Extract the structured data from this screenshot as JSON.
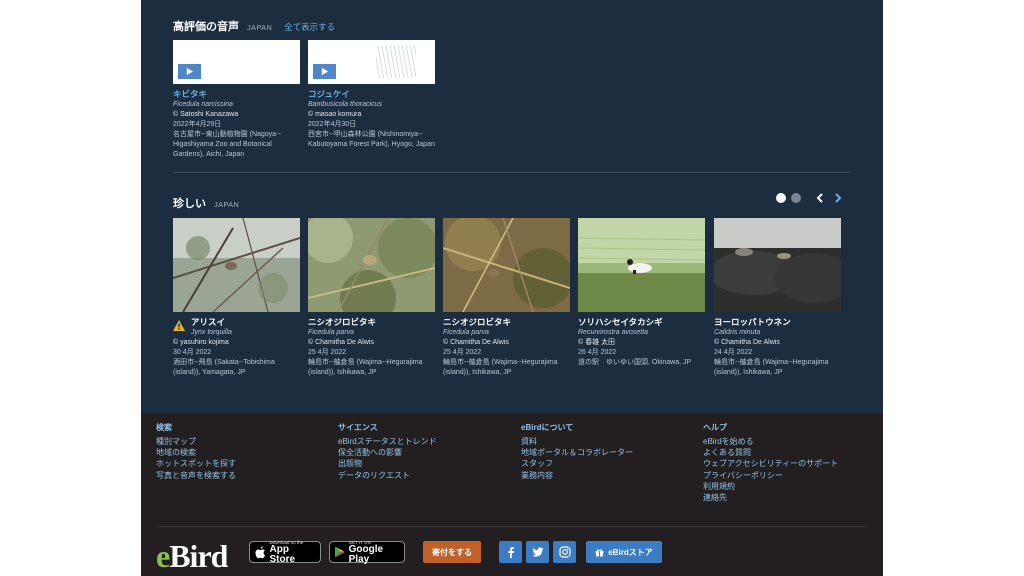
{
  "top_rated": {
    "title": "高評価の音声",
    "region": "JAPAN",
    "show_all": "全て表示する",
    "cards": [
      {
        "common": "キビタキ",
        "scientific": "Ficedula narcissina",
        "recorder": "© Satoshi Kanazawa",
        "date": "2022年4月29日",
        "location": "名古屋市--東山動植物園 (Nagoya--Higashiyama Zoo and Botanical Gardens), Aichi, Japan"
      },
      {
        "common": "コジュケイ",
        "scientific": "Bambusicola thoracicus",
        "recorder": "© masao komura",
        "date": "2022年4月30日",
        "location": "西宮市--甲山森林公園 (Nishinomiya--Kabutoyama Forest Park), Hyogo, Japan"
      }
    ]
  },
  "rare": {
    "title": "珍しい",
    "region": "JAPAN",
    "cards": [
      {
        "common": "アリスイ",
        "scientific": "Jynx torquilla",
        "recorder": "© yasuhiro kojima",
        "date": "30 4月 2022",
        "location": "酒田市--飛島 (Sakata--Tobishima (island)), Yamagata, JP",
        "warning": true
      },
      {
        "common": "ニシオジロビタキ",
        "scientific": "Ficedula parva",
        "recorder": "© Chamitha De Alwis",
        "date": "25 4月 2022",
        "location": "輪島市--舳倉島 (Wajima--Hegurajima (island)), Ishikawa, JP"
      },
      {
        "common": "ニシオジロビタキ",
        "scientific": "Ficedula parva",
        "recorder": "© Chamitha De Alwis",
        "date": "25 4月 2022",
        "location": "輪島市--舳倉島 (Wajima--Hegurajima (island)), Ishikawa, JP"
      },
      {
        "common": "ソリハシセイタカシギ",
        "scientific": "Recurvirostra avosetta",
        "recorder": "© 春雄 太田",
        "date": "26 4月 2022",
        "location": "道の駅　ゆいゆい国頭, Okinawa, JP"
      },
      {
        "common": "ヨーロッパトウネン",
        "scientific": "Calidris minuta",
        "recorder": "© Chamitha De Alwis",
        "date": "24 4月 2022",
        "location": "輪島市--舳倉島 (Wajima--Hegurajima (island)), Ishikawa, JP"
      }
    ]
  },
  "footer": {
    "columns": [
      {
        "heading": "検索",
        "links": [
          "種別マップ",
          "地域の検索",
          "ホットスポットを探す",
          "写真と音声を検索する"
        ]
      },
      {
        "heading": "サイエンス",
        "links": [
          "eBirdステータスとトレンド",
          "保全活動への影響",
          "出版物",
          "データのリクエスト"
        ]
      },
      {
        "heading": "eBirdについて",
        "links": [
          "資料",
          "地域ポータル＆コラボレーター",
          "スタッフ",
          "業務内容"
        ]
      },
      {
        "heading": "ヘルプ",
        "links": [
          "eBirdを始める",
          "よくある質問",
          "ウェブアクセシビリティーのサポート",
          "プライバシーポリシー",
          "利用規約",
          "連絡先"
        ]
      }
    ],
    "logo": "eBird",
    "app_store_small": "Download on the",
    "app_store_big": "App Store",
    "google_small": "GET IT ON",
    "google_big": "Google Play",
    "donate": "寄付をする",
    "store": "eBirdストア"
  },
  "colors": {
    "page_bg": "#1c2d3f",
    "footer_bg": "#231f20",
    "link": "#6cb0e0",
    "accent_blue": "#3b7cc4",
    "donate": "#c2602a"
  }
}
